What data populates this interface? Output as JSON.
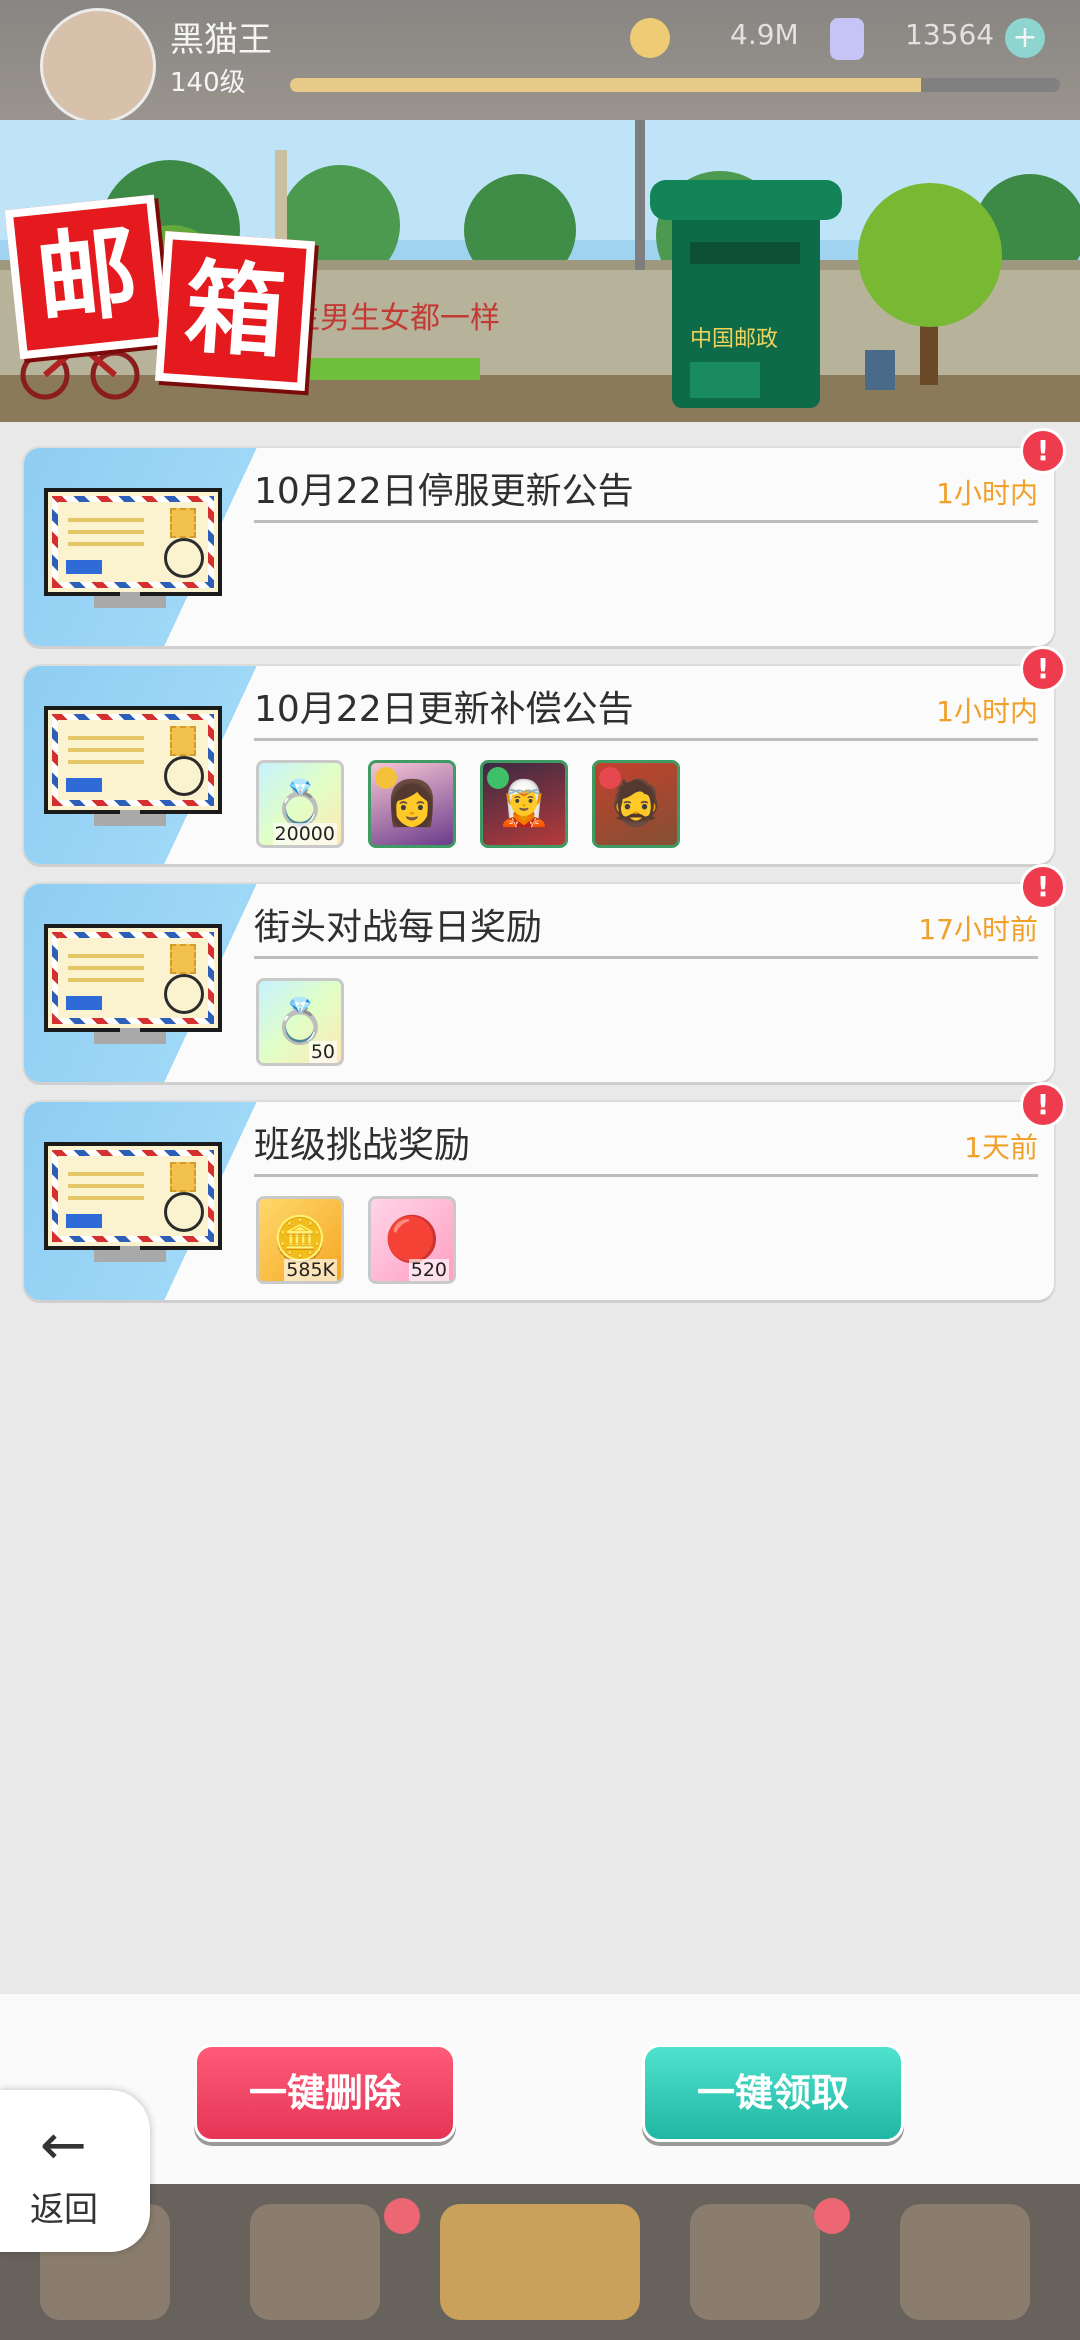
{
  "header": {
    "player_name": "黑猫王",
    "level": "140级",
    "coin_value": "4.9M",
    "gem_value": "13564",
    "plus_label": "+",
    "xp_progress": 0.82
  },
  "page_title": {
    "char1": "邮",
    "char2": "箱"
  },
  "banner": {
    "wall_text": "生男生女都一样",
    "postbox_text": "中国邮政"
  },
  "mails": [
    {
      "title": "10月22日停服更新公告",
      "time": "1小时内",
      "badge": "!",
      "rewards": []
    },
    {
      "title": "10月22日更新补偿公告",
      "time": "1小时内",
      "badge": "!",
      "rewards": [
        {
          "type": "gem",
          "count": "20000"
        },
        {
          "type": "hero",
          "count": ""
        },
        {
          "type": "hero",
          "count": ""
        },
        {
          "type": "hero",
          "count": ""
        }
      ]
    },
    {
      "title": "街头对战每日奖励",
      "time": "17小时前",
      "badge": "!",
      "rewards": [
        {
          "type": "gem",
          "count": "50"
        }
      ]
    },
    {
      "title": "班级挑战奖励",
      "time": "1天前",
      "badge": "!",
      "rewards": [
        {
          "type": "gold",
          "count": "585K"
        },
        {
          "type": "ticket",
          "count": "520"
        }
      ]
    }
  ],
  "actions": {
    "delete_all": "一键删除",
    "claim_all": "一键领取"
  },
  "back": {
    "label": "返回"
  },
  "colors": {
    "time_text": "#f1a02a",
    "badge": "#ef3b4e",
    "delete_button": "#e53556",
    "claim_button": "#1fb7a3",
    "title_red": "#e51a1e"
  }
}
